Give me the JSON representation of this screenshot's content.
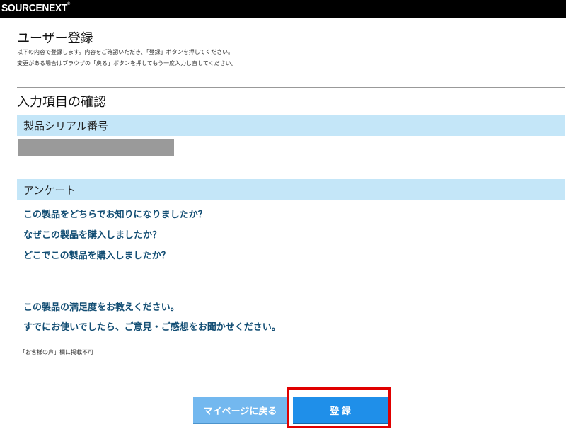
{
  "header": {
    "logo": "SOURCENEXT",
    "logo_mark": "®"
  },
  "page": {
    "title": "ユーザー登録",
    "intro_line1": "以下の内容で登録します。内容をご確認いただき、「登録」ボタンを押してください。",
    "intro_line2": "変更がある場合はブラウザの「戻る」ボタンを押してもう一度入力し直してください。",
    "section_title": "入力項目の確認"
  },
  "serial": {
    "label": "製品シリアル番号",
    "value_masked": true
  },
  "survey": {
    "label": "アンケート",
    "questions": [
      "この製品をどちらでお知りになりましたか？",
      "なぜこの製品を購入しましたか？",
      "どこでこの製品を購入しましたか？",
      "この製品の満足度をお教えください。",
      "すでにお使いでしたら、ご意見・ご感想をお聞かせください。"
    ]
  },
  "note": "「お客様の声」欄に掲載不可",
  "buttons": {
    "back_label": "マイページに戻る",
    "register_label": "登 録"
  },
  "colors": {
    "band": "#c4e6f8",
    "question_text": "#134e74",
    "back_button": "#73b8ef",
    "register_button": "#1f8fe9",
    "highlight_border": "#e00000"
  }
}
